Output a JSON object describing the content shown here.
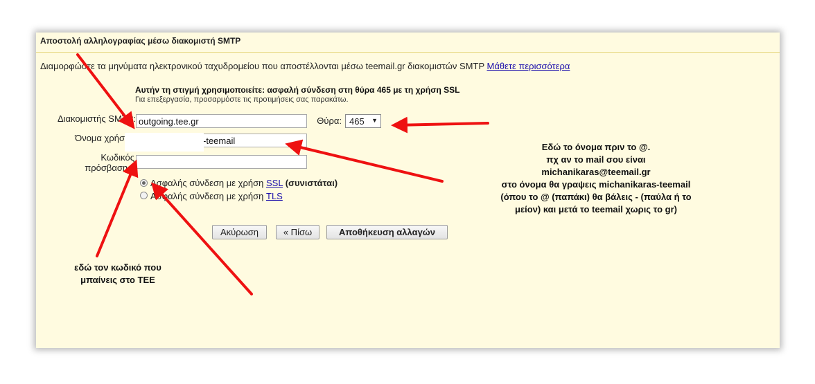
{
  "header": {
    "title": "Αποστολή αλληλογραφίας μέσω διακομιστή SMTP"
  },
  "description": {
    "text": "Διαμορφώστε τα μηνύματα ηλεκτρονικού ταχυδρομείου που αποστέλλονται μέσω teemail.gr διακομιστών SMTP ",
    "link": "Μάθετε περισσότερα"
  },
  "note": {
    "bold": "Αυτήν τη στιγμή χρησιμοποιείτε: ασφαλή σύνδεση στη θύρα 465 με τη χρήση SSL",
    "sub": "Για επεξεργασία, προσαρμόστε τις προτιμήσεις σας παρακάτω."
  },
  "form": {
    "smtp_label": "Διακομιστής SMTP:",
    "smtp_value": "outgoing.tee.gr",
    "port_label": "Θύρα:",
    "port_value": "465",
    "username_label": "Όνομα χρήστη:",
    "username_value": "-teemail",
    "password_label_line1": "Κωδικός",
    "password_label_line2": "πρόσβασης:",
    "password_value": "",
    "ssl_prefix": "Ασφαλής σύνδεση με χρήση ",
    "ssl_link": "SSL",
    "ssl_suffix": "(συνιστάται)",
    "tls_prefix": "Ασφαλής σύνδεση με χρήση ",
    "tls_link": "TLS",
    "ssl_selected": true
  },
  "buttons": {
    "cancel": "Ακύρωση",
    "back": "« Πίσω",
    "save": "Αποθήκευση αλλαγών"
  },
  "annotations": {
    "right": [
      "Εδώ το όνομα πριν το @.",
      "πχ αν το mail σου είναι",
      "michanikaras@teemail.gr",
      "στο όνομα θα γραψεις michanikaras-teemail",
      "(όπου το @ (παπάκι) θα βάλεις - (παύλα ή το",
      "μείον) και μετά το teemail χωρις το gr)"
    ],
    "left": [
      "εδώ τον κωδικό που",
      "μπαίνεις στο ΤΕΕ"
    ]
  },
  "colors": {
    "panel_background": "#fffbe0",
    "arrow": "#ee1111",
    "link": "#1a0dab"
  }
}
